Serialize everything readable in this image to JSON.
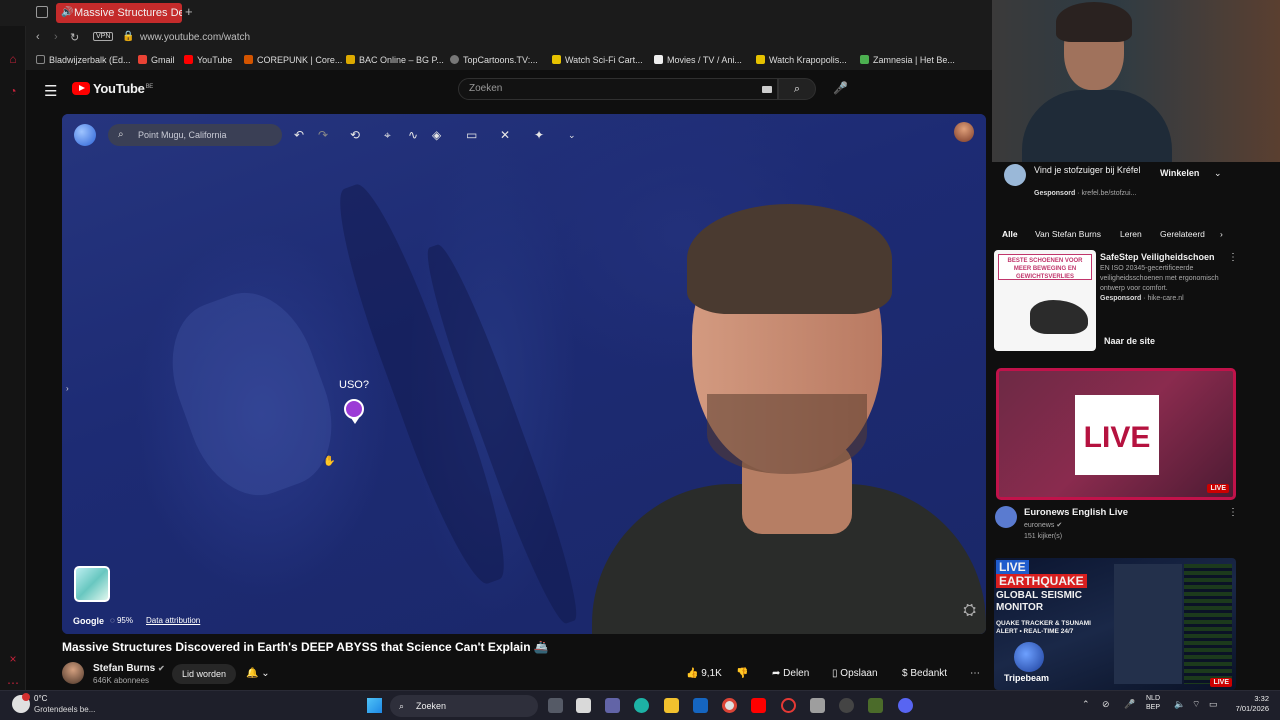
{
  "browser": {
    "tab_title": "Massive Structures De",
    "tab_plus": "+",
    "vpn_label": "VPN",
    "url": "www.youtube.com/watch",
    "bookmarks": [
      {
        "label": "Bladwijzerbalk (Ed...",
        "color": "#888888"
      },
      {
        "label": "Gmail",
        "color": "#ea4335"
      },
      {
        "label": "YouTube",
        "color": "#ff0000"
      },
      {
        "label": "COREPUNK | Core...",
        "color": "#d35400"
      },
      {
        "label": "BAC Online – BG P...",
        "color": "#ddaa00"
      },
      {
        "label": "TopCartoons.TV:...",
        "color": "#777777"
      },
      {
        "label": "Watch Sci-Fi Cart...",
        "color": "#e6c200"
      },
      {
        "label": "Movies / TV / Ani...",
        "color": "#eeeeee"
      },
      {
        "label": "Watch Krapopolis...",
        "color": "#e6c200"
      },
      {
        "label": "Zamnesia | Het Be...",
        "color": "#4caf50"
      }
    ]
  },
  "youtube": {
    "logo": "YouTube",
    "region": "BE",
    "search_placeholder": "Zoeken"
  },
  "video": {
    "maps_search": "Point Mugu, California",
    "marker_label": "USO?",
    "google_label": "Google",
    "percent": "95%",
    "attribution": "Data attribution",
    "title": "Massive Structures Discovered in Earth's DEEP ABYSS that Science Can't Explain",
    "channel": "Stefan Burns",
    "subscribers": "646K abonnees",
    "member_label": "Lid worden",
    "like_count": "9,1K",
    "share": "Delen",
    "save": "Opslaan",
    "thanks": "Bedankt"
  },
  "sidebar": {
    "sponsor_top": {
      "title": "Vind je stofzuiger bij Kréfel",
      "sponsored": "Gesponsord",
      "domain": "krefel.be/stofzui...",
      "cta": "Winkelen"
    },
    "chips": [
      "Alle",
      "Van Stefan Burns",
      "Leren",
      "Gerelateerd"
    ],
    "ad": {
      "banner": "BESTE SCHOENEN VOOR MEER BEWEGING EN GEWICHTSVERLIES",
      "title": "SafeStep Veiligheidschoen",
      "description": "EN ISO 20345-gecertificeerde veiligheidsschoenen met ergonomisch ontwerp voor comfort.",
      "sponsored": "Gesponsord",
      "domain": "hike-care.nl",
      "cta": "Naar de site"
    },
    "live_video": {
      "thumb_text": "LIVE",
      "badge": "LIVE",
      "title": "Euronews English Live",
      "channel": "euronews",
      "viewers": "151 kijker(s)"
    },
    "quake_video": {
      "tag": "LIVE",
      "headline": "EARTHQUAKE",
      "subtitle": "GLOBAL SEISMIC MONITOR",
      "small": "QUAKE TRACKER & TSUNAMI ALERT • REAL-TIME 24/7",
      "brand": "Tripebeam",
      "badge": "LIVE"
    }
  },
  "taskbar": {
    "temperature": "0°C",
    "condition": "Grotendeels be...",
    "search": "Zoeken",
    "lang": "NLD",
    "lang2": "BEP",
    "time": "3:32",
    "date": "7/01/2026"
  },
  "colors": {
    "accent_red": "#c42b2b",
    "youtube_red": "#ff0000",
    "ocean_blue": "#1c2b73"
  }
}
